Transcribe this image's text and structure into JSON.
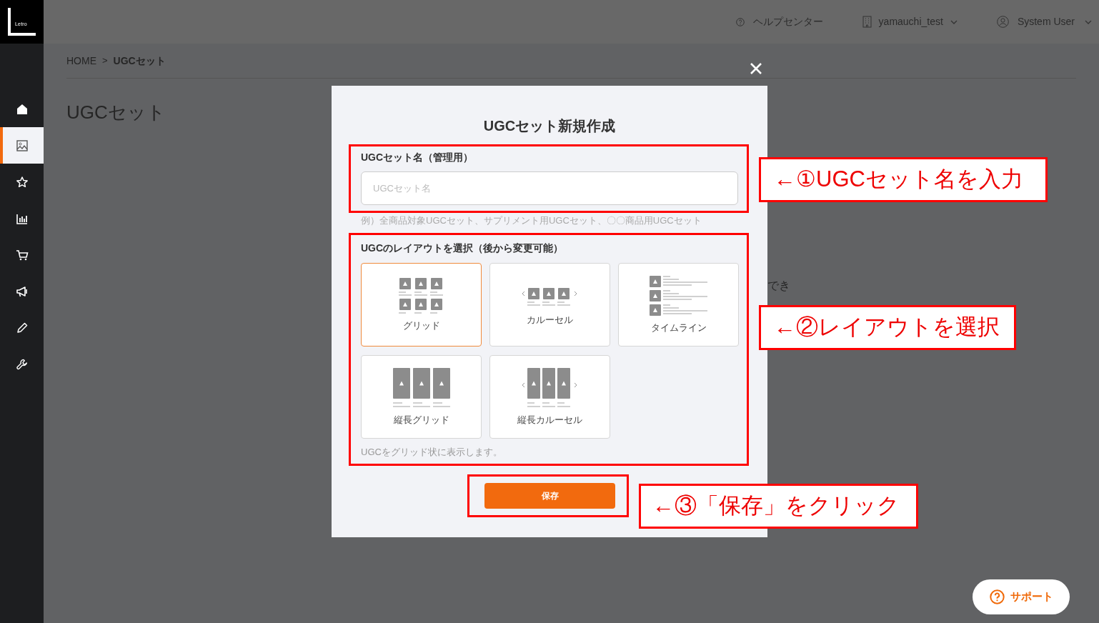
{
  "logo": {
    "text": "Letro"
  },
  "header": {
    "help": "ヘルプセンター",
    "account": "yamauchi_test",
    "user": "System User"
  },
  "sidebar": {
    "items": [
      {
        "kind": "home",
        "selected": false
      },
      {
        "kind": "image",
        "selected": true
      },
      {
        "kind": "star",
        "selected": false
      },
      {
        "kind": "chart",
        "selected": false
      },
      {
        "kind": "cart",
        "selected": false
      },
      {
        "kind": "megaphone",
        "selected": false
      },
      {
        "kind": "pencil",
        "selected": false
      },
      {
        "kind": "wrench",
        "selected": false
      }
    ]
  },
  "breadcrumb": [
    {
      "label": "HOME",
      "current": false
    },
    {
      "label": "UGCセット",
      "current": true
    }
  ],
  "breadcrumb_separator": ">",
  "page_title": "UGCセット",
  "background_text": "でき",
  "modal": {
    "title": "UGCセット新規作成",
    "name_field": {
      "label": "UGCセット名（管理用）",
      "placeholder": "UGCセット名",
      "hint": "例）全商品対象UGCセット、サプリメント用UGCセット、〇〇商品用UGCセット"
    },
    "layout": {
      "label": "UGCのレイアウトを選択（後から変更可能）",
      "options": [
        {
          "kind": "grid",
          "label": "グリッド",
          "selected": true
        },
        {
          "kind": "carousel",
          "label": "カルーセル",
          "selected": false
        },
        {
          "kind": "timeline",
          "label": "タイムライン",
          "selected": false
        },
        {
          "kind": "tall-grid",
          "label": "縦長グリッド",
          "selected": false
        },
        {
          "kind": "tall-carousel",
          "label": "縦長カルーセル",
          "selected": false
        }
      ],
      "description": "UGCをグリッド状に表示します。"
    },
    "save_button": "保存"
  },
  "annotations": [
    {
      "text": "←①UGCセット名を入力"
    },
    {
      "text": "←②レイアウトを選択"
    },
    {
      "text": "←③「保存」をクリック"
    }
  ],
  "support_button": "サポート"
}
